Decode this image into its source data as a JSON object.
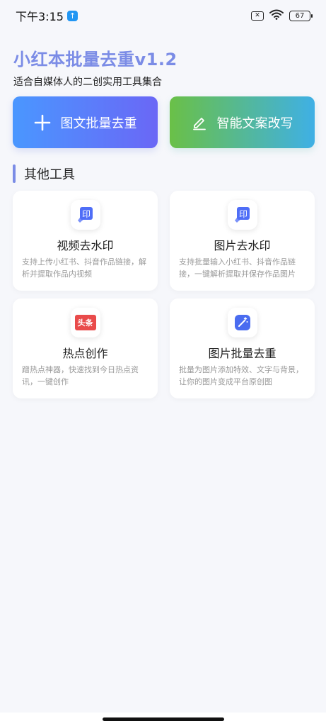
{
  "status_bar": {
    "time": "下午3:15",
    "notification_icon": "app-update-icon",
    "battery": "67"
  },
  "header": {
    "title": "小红本批量去重v1.2",
    "subtitle": "适合自媒体人的二创实用工具集合",
    "title_color": "#7b8ce6"
  },
  "actions": {
    "primary_label": "图文批量去重",
    "primary_icon": "plus-icon",
    "secondary_label": "智能文案改写",
    "secondary_icon": "edit-pen-icon"
  },
  "section": {
    "title": "其他工具"
  },
  "tools": [
    {
      "title": "视频去水印",
      "desc": "支持上传小红书、抖音作品链接，解析并提取作品内视频",
      "icon": "watermark-icon",
      "icon_text": "印"
    },
    {
      "title": "图片去水印",
      "desc": "支持批量输入小红书、抖音作品链接，一键解析提取并保存作品图片",
      "icon": "watermark-icon",
      "icon_text": "印"
    },
    {
      "title": "热点创作",
      "desc": "蹭热点神器，快速找到今日热点资讯，一键创作",
      "icon": "toutiao-icon",
      "icon_text": "头条"
    },
    {
      "title": "图片批量去重",
      "desc": "批量为图片添加特效、文字与背景，让你的图片变成平台原创图",
      "icon": "magic-wand-icon"
    }
  ]
}
